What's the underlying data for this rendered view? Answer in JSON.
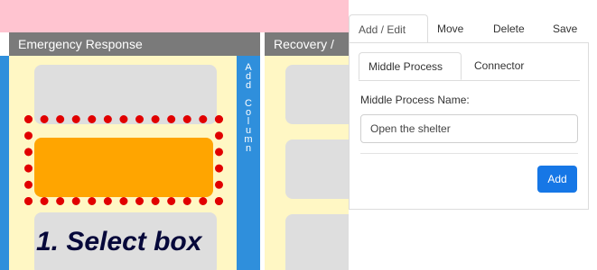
{
  "canvas": {
    "columns": [
      {
        "title": "Emergency Response"
      },
      {
        "title": "Recovery /"
      }
    ],
    "add_column_letters": [
      "A",
      "d",
      "d",
      " ",
      "C",
      "o",
      "l",
      "u",
      "m",
      "n"
    ],
    "caption": "1. Select box"
  },
  "panel": {
    "tabs": [
      {
        "label": "Add / Edit",
        "active": true
      },
      {
        "label": "Move"
      },
      {
        "label": "Delete"
      },
      {
        "label": "Save"
      }
    ],
    "subtabs": [
      {
        "label": "Middle Process",
        "active": true
      },
      {
        "label": "Connector"
      }
    ],
    "field_label": "Middle Process Name:",
    "field_value": "Open the shelter",
    "add_button": "Add"
  },
  "colors": {
    "topbar": "#ffc4d0",
    "header": "#7a7a7a",
    "lane": "#fff7c4",
    "lane_bar": "#2f8fdc",
    "selected_box": "#ffa500",
    "highlight": "#e10000",
    "button": "#1677e6"
  }
}
